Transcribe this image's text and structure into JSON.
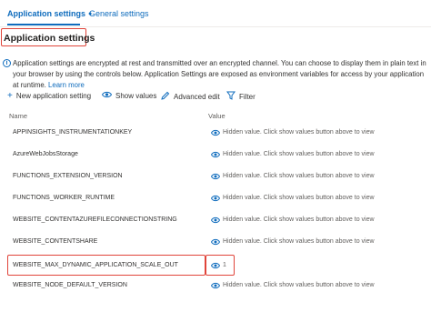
{
  "tabs": {
    "active_label": "Application settings",
    "active_marker": "●",
    "inactive_label": "General settings"
  },
  "section": {
    "title": "Application settings"
  },
  "info": {
    "icon": "info-icon",
    "text": "Application settings are encrypted at rest and transmitted over an encrypted channel. You can choose to display them in plain text in your browser by using the controls below. Application Settings are exposed as environment variables for access by your application at runtime.",
    "link_label": "Learn more"
  },
  "toolbar": {
    "new_label": "New application setting",
    "show_label": "Show values",
    "advanced_label": "Advanced edit",
    "filter_label": "Filter"
  },
  "table": {
    "columns": [
      "Name",
      "Value"
    ],
    "rows": [
      {
        "name": "APPINSIGHTS_INSTRUMENTATIONKEY",
        "value": "Hidden value. Click show values button above to view"
      },
      {
        "name": "AzureWebJobsStorage",
        "value": "Hidden value. Click show values button above to view"
      },
      {
        "name": "FUNCTIONS_EXTENSION_VERSION",
        "value": "Hidden value. Click show values button above to view"
      },
      {
        "name": "FUNCTIONS_WORKER_RUNTIME",
        "value": "Hidden value. Click show values button above to view"
      },
      {
        "name": "WEBSITE_CONTENTAZUREFILECONNECTIONSTRING",
        "value": "Hidden value. Click show values button above to view"
      },
      {
        "name": "WEBSITE_CONTENTSHARE",
        "value": "Hidden value. Click show values button above to view"
      },
      {
        "name": "WEBSITE_MAX_DYNAMIC_APPLICATION_SCALE_OUT",
        "value": "1"
      },
      {
        "name": "WEBSITE_NODE_DEFAULT_VERSION",
        "value": "Hidden value. Click show values button above to view"
      }
    ]
  },
  "colors": {
    "accent": "#0f6cbd",
    "highlight": "#e0443a"
  }
}
